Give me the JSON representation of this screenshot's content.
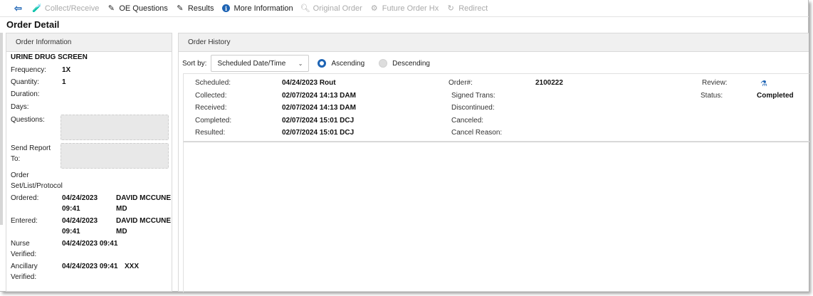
{
  "toolbar": {
    "back_icon": "back-arrow-icon",
    "items": [
      {
        "label": "Collect/Receive",
        "icon": "collect-icon",
        "enabled": false
      },
      {
        "label": "OE Questions",
        "icon": "edit-icon",
        "enabled": true
      },
      {
        "label": "Results",
        "icon": "edit-icon",
        "enabled": true
      },
      {
        "label": "More Information",
        "icon": "info-icon",
        "enabled": true
      },
      {
        "label": "Original Order",
        "icon": "search-icon",
        "enabled": false
      },
      {
        "label": "Future Order Hx",
        "icon": "future-order-icon",
        "enabled": false
      },
      {
        "label": "Redirect",
        "icon": "redirect-icon",
        "enabled": false
      }
    ]
  },
  "page_title": "Order Detail",
  "order_info": {
    "header": "Order Information",
    "test_name": "URINE DRUG SCREEN",
    "frequency_label": "Frequency:",
    "frequency": "1X",
    "quantity_label": "Quantity:",
    "quantity": "1",
    "duration_label": "Duration:",
    "days_label": "Days:",
    "questions_label": "Questions:",
    "send_report_label_1": "Send Report",
    "send_report_label_2": "To:",
    "order_set_label_1": "Order",
    "order_set_label_2": "Set/List/Protocol",
    "ordered_label": "Ordered:",
    "ordered_date": "04/24/2023",
    "ordered_time": "09:41",
    "ordered_by_1": "DAVID MCCUNE",
    "ordered_by_2": "MD",
    "entered_label": "Entered:",
    "entered_date": "04/24/2023",
    "entered_time": "09:41",
    "entered_by_1": "DAVID MCCUNE",
    "entered_by_2": "MD",
    "nurse_label_1": "Nurse",
    "nurse_label_2": "Verified:",
    "nurse_verified": "04/24/2023 09:41",
    "ancillary_label_1": "Ancillary",
    "ancillary_label_2": "Verified:",
    "ancillary_verified": "04/24/2023 09:41",
    "ancillary_by": "XXX"
  },
  "order_history": {
    "header": "Order History",
    "sort_label": "Sort by:",
    "sort_value": "Scheduled Date/Time",
    "ascending_label": "Ascending",
    "descending_label": "Descending",
    "scheduled_label": "Scheduled:",
    "scheduled": "04/24/2023 Rout",
    "collected_label": "Collected:",
    "collected": "02/07/2024 14:13 DAM",
    "received_label": "Received:",
    "received": "02/07/2024 14:13 DAM",
    "completed_label": "Completed:",
    "completed": "02/07/2024 15:01 DCJ",
    "resulted_label": "Resulted:",
    "resulted": "02/07/2024 15:01 DCJ",
    "order_num_label": "Order#:",
    "order_num": "2100222",
    "signed_trans_label": "Signed Trans:",
    "discontinued_label": "Discontinued:",
    "canceled_label": "Canceled:",
    "cancel_reason_label": "Cancel Reason:",
    "review_label": "Review:",
    "review_icon": "flask-icon",
    "status_label": "Status:",
    "status": "Completed"
  }
}
